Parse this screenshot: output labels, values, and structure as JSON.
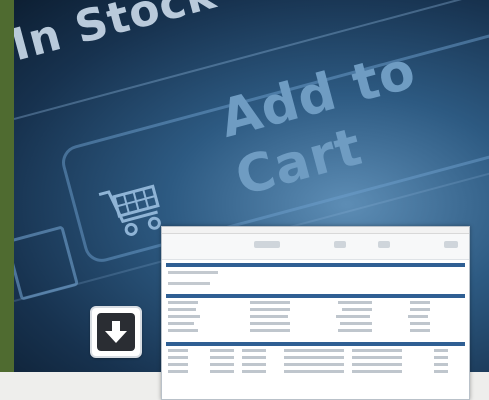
{
  "hero": {
    "line1": "In Stock",
    "line2": "Add to Cart"
  },
  "icons": {
    "cart": "shopping-cart-icon",
    "download": "arrow-down-icon"
  },
  "colors": {
    "hero_dark": "#17324f",
    "hero_mid": "#2d5a82",
    "hero_light": "#5d8db5",
    "green_stripe": "#4f6b30",
    "thumbnail_header": "#2f5f93"
  }
}
